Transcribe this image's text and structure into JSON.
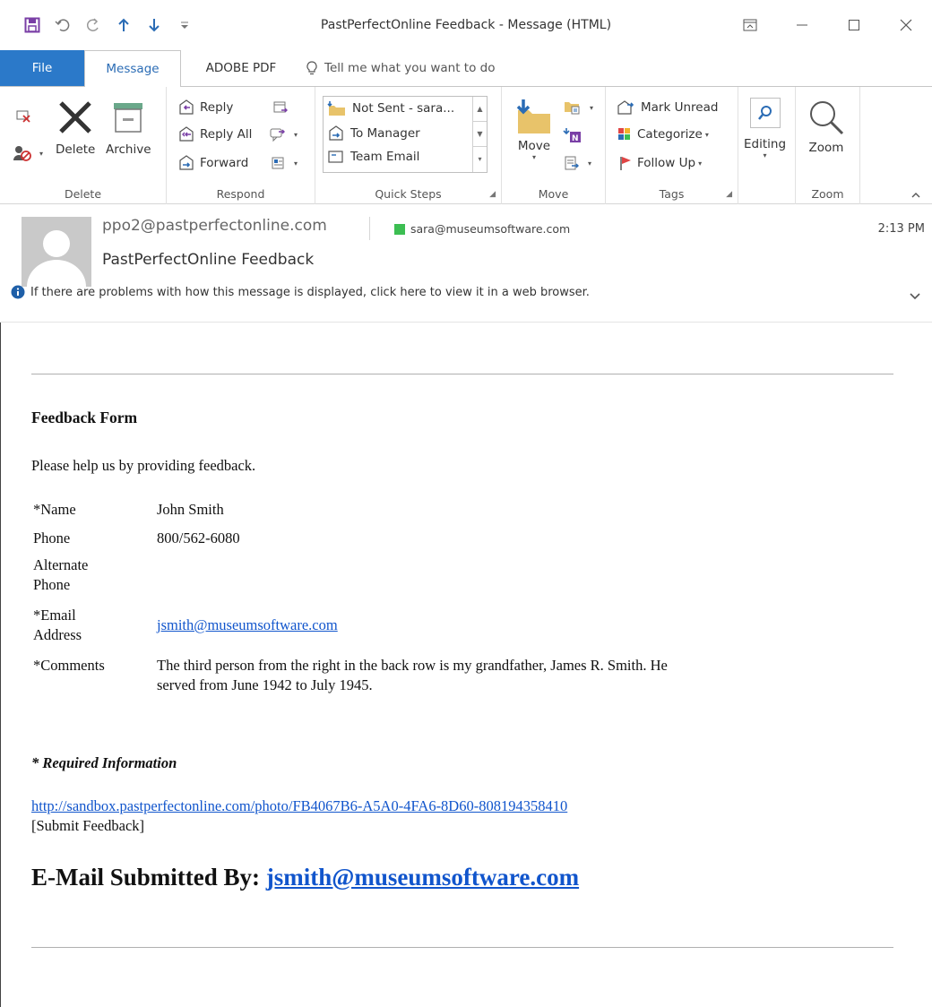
{
  "window": {
    "title": "PastPerfectOnline Feedback - Message (HTML)"
  },
  "tabs": {
    "file": "File",
    "message": "Message",
    "adobe": "ADOBE PDF",
    "tell_me": "Tell me what you want to do"
  },
  "ribbon": {
    "delete_group": {
      "label": "Delete",
      "delete": "Delete",
      "archive": "Archive"
    },
    "respond_group": {
      "label": "Respond",
      "reply": "Reply",
      "reply_all": "Reply All",
      "forward": "Forward"
    },
    "quick_steps_group": {
      "label": "Quick Steps",
      "items": [
        "Not Sent - sara...",
        "To Manager",
        "Team Email"
      ]
    },
    "move_group": {
      "label": "Move",
      "move": "Move"
    },
    "tags_group": {
      "label": "Tags",
      "mark_unread": "Mark Unread",
      "categorize": "Categorize",
      "follow_up": "Follow Up"
    },
    "editing_group": {
      "editing": "Editing"
    },
    "zoom_group": {
      "label": "Zoom",
      "zoom": "Zoom"
    }
  },
  "header": {
    "from": "ppo2@pastperfectonline.com",
    "to": "sara@museumsoftware.com",
    "time": "2:13 PM",
    "subject": "PastPerfectOnline Feedback",
    "info": "If there are problems with how this message is displayed, click here to view it in a web browser."
  },
  "body": {
    "form_title": "Feedback Form",
    "intro": "Please help us by providing feedback.",
    "fields": {
      "name": {
        "label": "*Name",
        "value": "John Smith"
      },
      "phone": {
        "label": "Phone",
        "value": "800/562-6080"
      },
      "alt_phone": {
        "label_1": "Alternate",
        "label_2": "Phone",
        "value": ""
      },
      "email": {
        "label_1": "*Email",
        "label_2": "Address",
        "value": "jsmith@museumsoftware.com"
      },
      "comments": {
        "label": "*Comments",
        "line_1": "The third person from the right in the back row is my grandfather, James R. Smith. He",
        "line_2": "served from June 1942 to July 1945."
      }
    },
    "required_note": "* Required Information",
    "photo_url": "http://sandbox.pastperfectonline.com/photo/FB4067B6-A5A0-4FA6-8D60-808194358410",
    "submit_text": "[Submit Feedback]",
    "submitted_by_label": "E-Mail Submitted By:",
    "submitted_by_email": "jsmith@museumsoftware.com"
  },
  "colors": {
    "file_tab": "#2b79c9",
    "accent": "#2b6cb5",
    "link": "#1155cc",
    "recipient_status": "#3cbe52"
  },
  "icons": [
    "save-icon",
    "undo-icon",
    "redo-icon",
    "up-arrow-icon",
    "down-arrow-icon",
    "customize-icon",
    "restore-ribbon-icon",
    "minimize-icon",
    "maximize-icon",
    "close-icon",
    "lightbulb-icon",
    "ignore-icon",
    "junk-icon",
    "delete-icon",
    "archive-icon",
    "reply-icon",
    "reply-all-icon",
    "forward-icon",
    "meeting-icon",
    "im-icon",
    "more-respond-icon",
    "move-folder-icon",
    "rules-icon",
    "onenote-icon",
    "actions-icon",
    "mark-unread-icon",
    "categorize-icon",
    "follow-up-flag-icon",
    "search-icon",
    "zoom-icon",
    "collapse-ribbon-icon",
    "person-placeholder-icon",
    "info-icon",
    "chevron-down-icon"
  ]
}
